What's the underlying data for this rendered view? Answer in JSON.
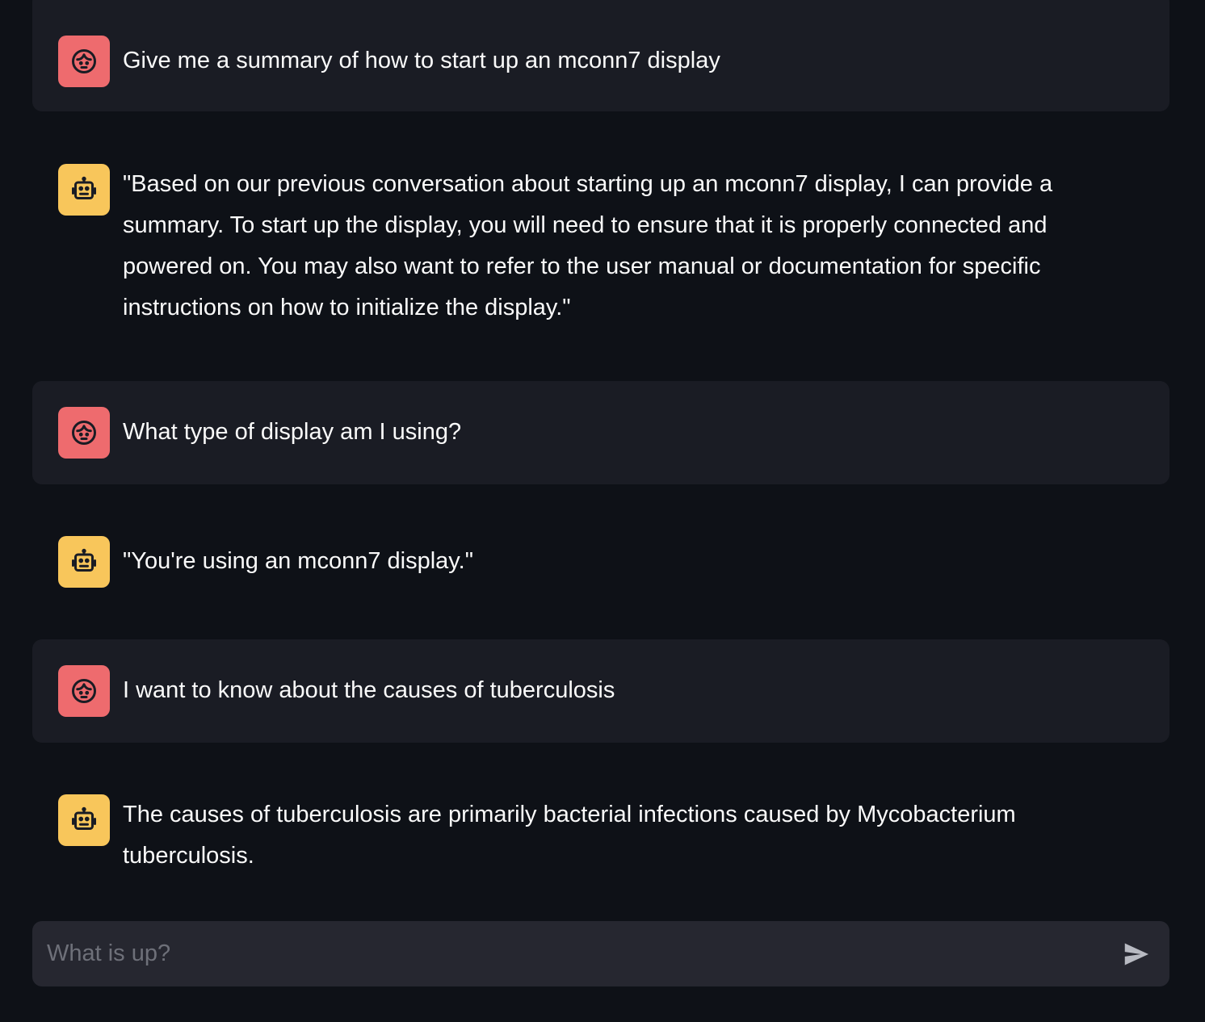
{
  "colors": {
    "background": "#0e1117",
    "user_bubble": "#1a1c24",
    "user_avatar": "#ee6b6e",
    "assistant_avatar": "#f8c65b",
    "input_background": "#262730",
    "text": "#fafafa",
    "placeholder": "#6e7079"
  },
  "messages": [
    {
      "role": "user",
      "icon": "user-face-icon",
      "text": "Give me a summary of how to start up an mconn7 display"
    },
    {
      "role": "assistant",
      "icon": "robot-icon",
      "text": "\"Based on our previous conversation about starting up an mconn7 display, I can provide a summary. To start up the display, you will need to ensure that it is properly connected and powered on. You may also want to refer to the user manual or documentation for specific instructions on how to initialize the display.\""
    },
    {
      "role": "user",
      "icon": "user-face-icon",
      "text": "What type of display am I using?"
    },
    {
      "role": "assistant",
      "icon": "robot-icon",
      "text": "\"You're using an mconn7 display.\""
    },
    {
      "role": "user",
      "icon": "user-face-icon",
      "text": "I want to know about the causes of tuberculosis"
    },
    {
      "role": "assistant",
      "icon": "robot-icon",
      "text": "The causes of tuberculosis are primarily bacterial infections caused by Mycobacterium tuberculosis."
    }
  ],
  "chat_input": {
    "placeholder": "What is up?",
    "value": "",
    "send_icon": "send-icon"
  }
}
